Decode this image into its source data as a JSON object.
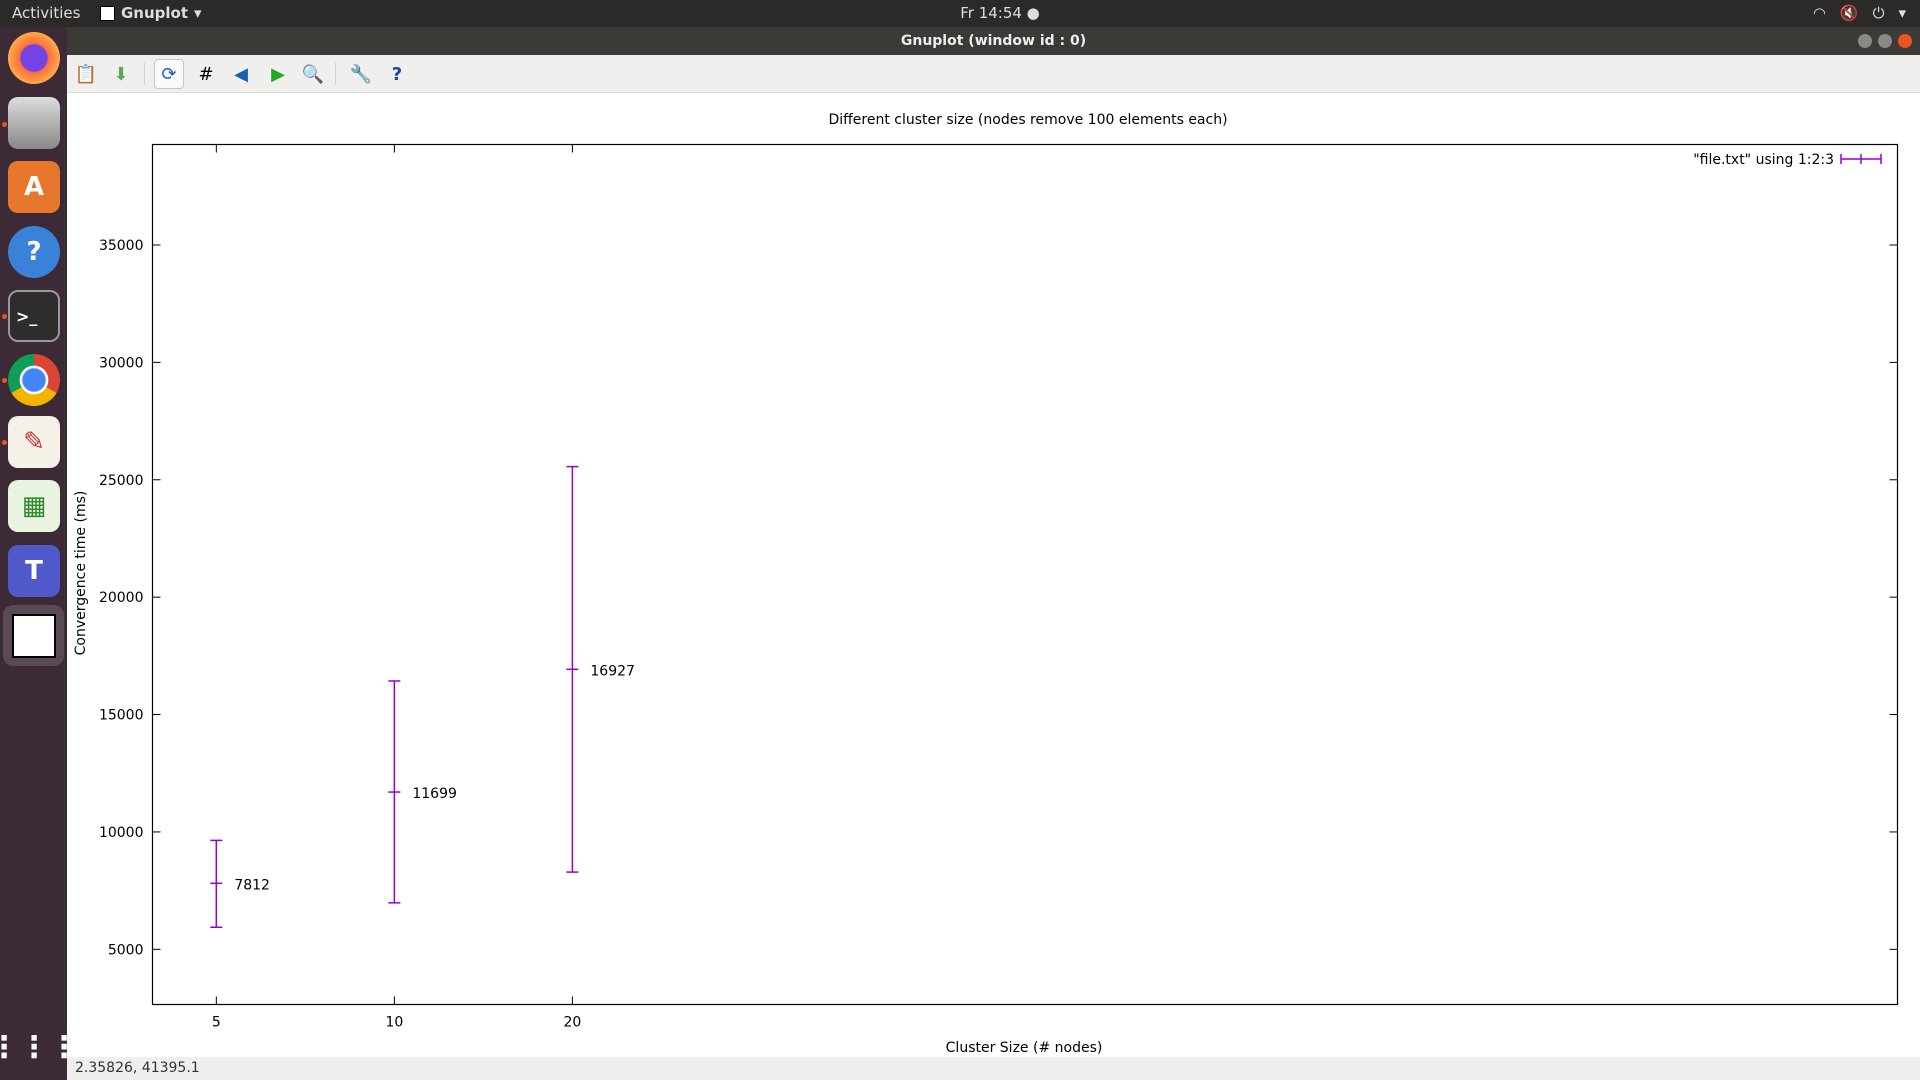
{
  "topbar": {
    "activities": "Activities",
    "app_name": "Gnuplot",
    "clock": "Fr 14:54 ●",
    "tray": [
      "wifi-icon",
      "volume-muted-icon",
      "power-icon"
    ]
  },
  "window": {
    "title": "Gnuplot (window id : 0)"
  },
  "dock": {
    "items": [
      "firefox",
      "files",
      "software-center",
      "help",
      "terminal",
      "chrome",
      "text-editor",
      "spreadsheet",
      "teams",
      "gnuplot",
      "show-applications"
    ]
  },
  "toolbar": {
    "items": [
      "copy-clipboard",
      "export",
      "replot",
      "grid",
      "previous-zoom",
      "next-zoom",
      "autoscale",
      "options",
      "help"
    ]
  },
  "status": {
    "coords": "2.35826,  41395.1"
  },
  "chart_data": {
    "type": "errorbar",
    "title": "Different cluster size (nodes remove 100 elements each)",
    "xlabel": "Cluster Size (# nodes)",
    "ylabel": "Convergence time (ms)",
    "x_scale": "log",
    "xlim": [
      3.9,
      3480
    ],
    "ylim": [
      2650,
      39280
    ],
    "xticks": [
      5,
      10,
      20
    ],
    "yticks": [
      5000,
      10000,
      15000,
      20000,
      25000,
      30000,
      35000
    ],
    "grid": false,
    "legend": {
      "position": "top-right",
      "entry": "\"file.txt\" using 1:2:3"
    },
    "series_color": "#9400d3",
    "points": [
      {
        "x": 5,
        "y": 7812,
        "low": 5940,
        "high": 9640,
        "label": "7812"
      },
      {
        "x": 10,
        "y": 11699,
        "low": 6980,
        "high": 16430,
        "label": "11699"
      },
      {
        "x": 20,
        "y": 16927,
        "low": 8290,
        "high": 25560,
        "label": "16927"
      }
    ]
  }
}
